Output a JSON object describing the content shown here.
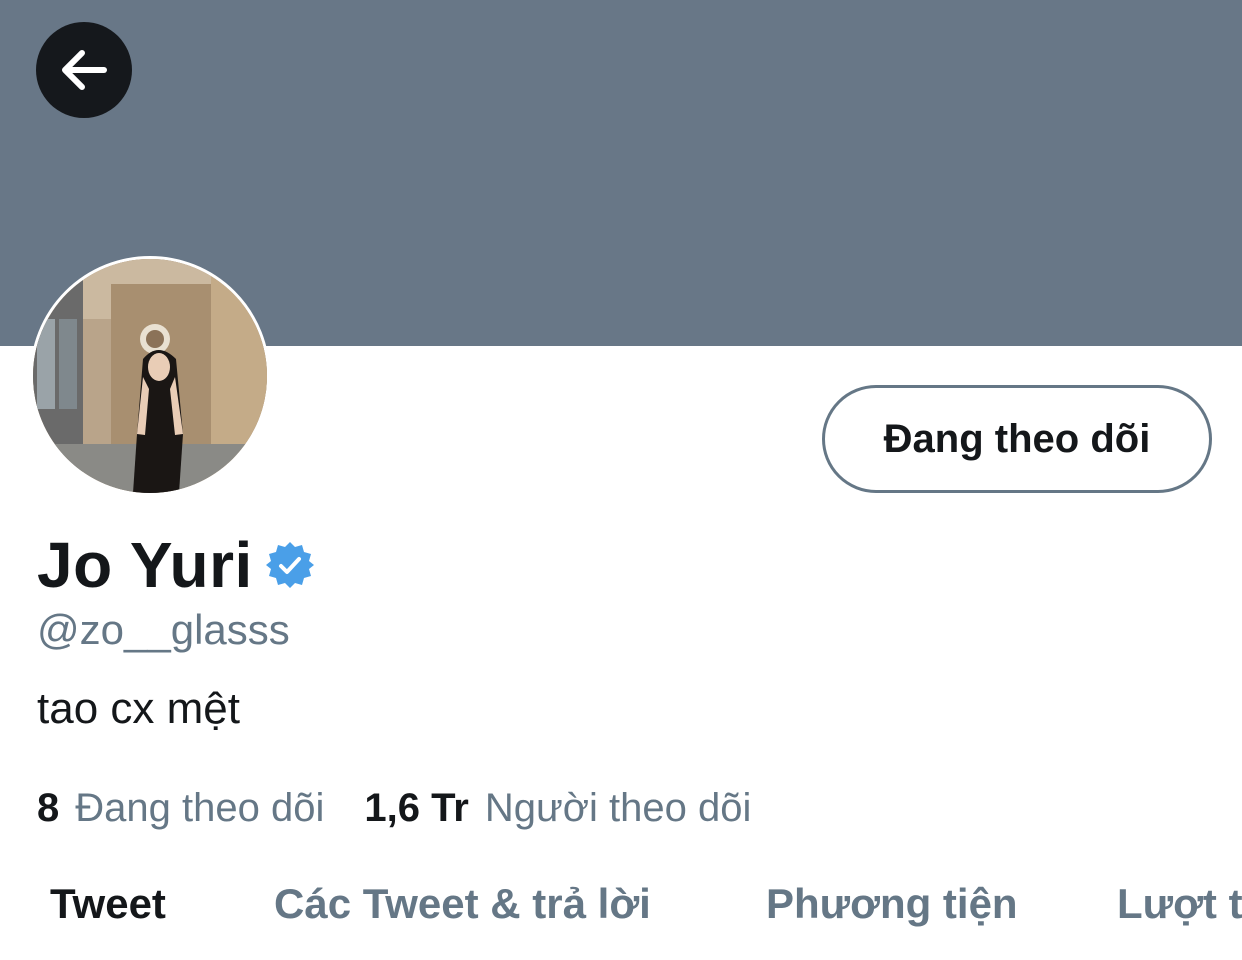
{
  "colors": {
    "banner": "#687787",
    "back_button_bg": "#15181c",
    "verified_badge": "#4a9fe8",
    "text_primary": "#14171a",
    "text_secondary": "#657786"
  },
  "header": {
    "back_icon": "arrow-left-icon"
  },
  "profile": {
    "avatar_icon": "profile-photo",
    "follow_button_label": "Đang theo dõi",
    "display_name": "Jo Yuri",
    "verified_icon": "verified-badge-icon",
    "handle": "@zo__glasss",
    "bio": "tao cx mệt"
  },
  "stats": {
    "following_count": "8",
    "following_label": "Đang theo dõi",
    "followers_count": "1,6 Tr",
    "followers_label": "Người theo dõi"
  },
  "tabs": [
    {
      "label": "Tweet",
      "active": true
    },
    {
      "label": "Các Tweet & trả lời",
      "active": false
    },
    {
      "label": "Phương tiện",
      "active": false
    },
    {
      "label": "Lượt t",
      "active": false
    }
  ]
}
